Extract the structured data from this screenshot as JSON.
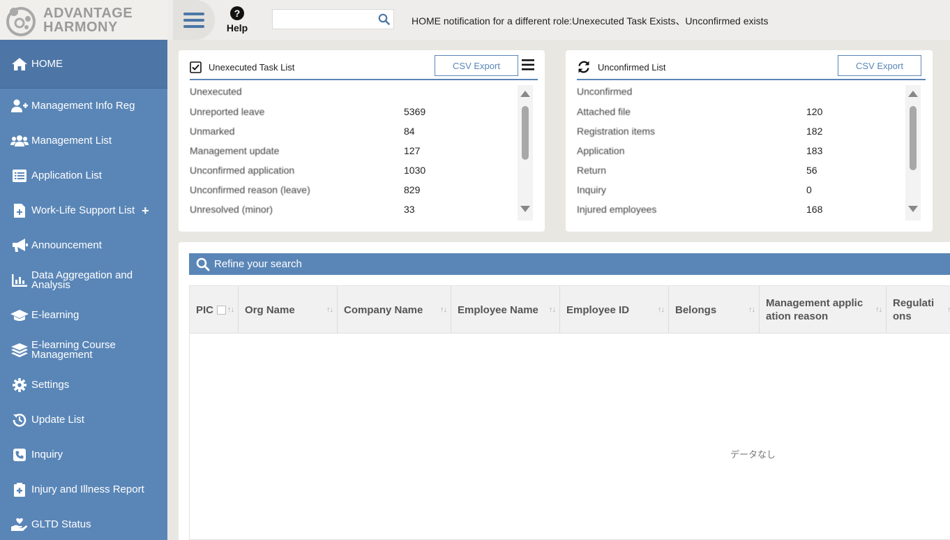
{
  "logo": {
    "line1": "ADVANTAGE",
    "line2": "HARMONY"
  },
  "header": {
    "help_label": "Help",
    "search_placeholder": "",
    "notification": "HOME notification for a different role:Unexecuted Task Exists、Unconfirmed exists"
  },
  "sidebar": {
    "items": [
      {
        "label": "HOME",
        "icon": "home-icon",
        "active": true
      },
      {
        "label": "Management Info Reg",
        "icon": "user-plus-icon"
      },
      {
        "label": "Management List",
        "icon": "users-icon"
      },
      {
        "label": "Application List",
        "icon": "list-icon"
      },
      {
        "label": "Work-Life Support List",
        "icon": "file-plus-icon",
        "plus": "+"
      },
      {
        "label": "Announcement",
        "icon": "megaphone-icon"
      },
      {
        "label": "Data Aggregation and Analysis",
        "icon": "bar-chart-icon"
      },
      {
        "label": "E-learning",
        "icon": "graduation-cap-icon"
      },
      {
        "label": "E-learning Course Management",
        "icon": "layers-icon"
      },
      {
        "label": "Settings",
        "icon": "gear-icon"
      },
      {
        "label": "Update List",
        "icon": "history-icon"
      },
      {
        "label": "Inquiry",
        "icon": "phone-icon"
      },
      {
        "label": "Injury and Illness Report",
        "icon": "medical-file-icon"
      },
      {
        "label": "GLTD Status",
        "icon": "hand-heart-icon"
      }
    ]
  },
  "unexecuted": {
    "title": "Unexecuted Task List",
    "csv_label": "CSV Export",
    "rows": [
      {
        "name": "Unexecuted",
        "value": ""
      },
      {
        "name": "Unreported leave",
        "value": "5369"
      },
      {
        "name": "Unmarked",
        "value": "84"
      },
      {
        "name": "Management update",
        "value": "127"
      },
      {
        "name": "Unconfirmed application",
        "value": "1030"
      },
      {
        "name": "Unconfirmed reason (leave)",
        "value": "829"
      },
      {
        "name": "Unresolved (minor)",
        "value": "33"
      }
    ]
  },
  "unconfirmed": {
    "title": "Unconfirmed List",
    "csv_label": "CSV Export",
    "rows": [
      {
        "name": "Unconfirmed",
        "value": ""
      },
      {
        "name": "Attached file",
        "value": "120"
      },
      {
        "name": "Registration items",
        "value": "182"
      },
      {
        "name": "Application",
        "value": "183"
      },
      {
        "name": "Return",
        "value": "56"
      },
      {
        "name": "Inquiry",
        "value": "0"
      },
      {
        "name": "Injured employees",
        "value": "168"
      }
    ]
  },
  "search_panel": {
    "refine_label": "Refine your search",
    "columns": [
      "PIC",
      "Org Name",
      "Company Name",
      "Employee Name",
      "Employee ID",
      "Belongs",
      "Management application reason",
      "Regulations"
    ],
    "sort_glyph": "↑↓",
    "no_data": "データなし"
  },
  "colors": {
    "sidebar": "#5a86b7",
    "sidebar_active": "#4d76a6",
    "accent": "#5a86b7"
  }
}
